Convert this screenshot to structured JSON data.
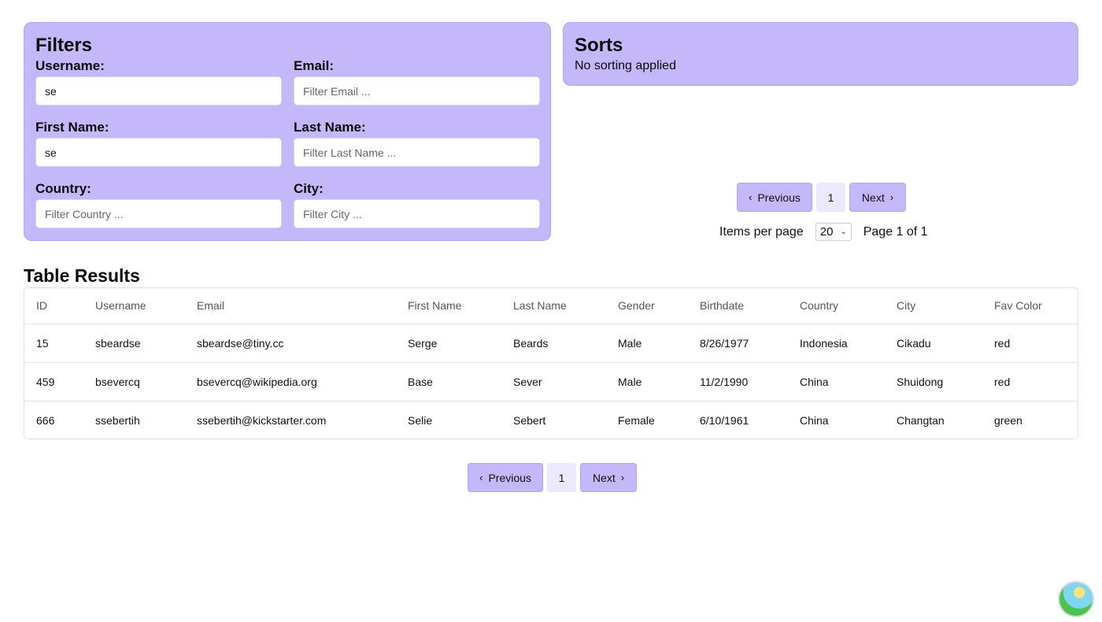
{
  "filters": {
    "title": "Filters",
    "fields": [
      {
        "label": "Username:",
        "value": "se",
        "placeholder": ""
      },
      {
        "label": "Email:",
        "value": "",
        "placeholder": "Filter Email ..."
      },
      {
        "label": "First Name:",
        "value": "se",
        "placeholder": ""
      },
      {
        "label": "Last Name:",
        "value": "",
        "placeholder": "Filter Last Name ..."
      },
      {
        "label": "Country:",
        "value": "",
        "placeholder": "Filter Country ..."
      },
      {
        "label": "City:",
        "value": "",
        "placeholder": "Filter City ..."
      }
    ]
  },
  "sorts": {
    "title": "Sorts",
    "status": "No sorting applied"
  },
  "pagination": {
    "previous_label": "Previous",
    "next_label": "Next",
    "current_page": "1",
    "items_per_page_label": "Items per page",
    "items_per_page_value": "20",
    "page_info": "Page 1 of 1"
  },
  "results": {
    "title": "Table Results",
    "columns": [
      "ID",
      "Username",
      "Email",
      "First Name",
      "Last Name",
      "Gender",
      "Birthdate",
      "Country",
      "City",
      "Fav Color"
    ],
    "rows": [
      [
        "15",
        "sbeardse",
        "sbeardse@tiny.cc",
        "Serge",
        "Beards",
        "Male",
        "8/26/1977",
        "Indonesia",
        "Cikadu",
        "red"
      ],
      [
        "459",
        "bsevercq",
        "bsevercq@wikipedia.org",
        "Base",
        "Sever",
        "Male",
        "11/2/1990",
        "China",
        "Shuidong",
        "red"
      ],
      [
        "666",
        "ssebertih",
        "ssebertih@kickstarter.com",
        "Selie",
        "Sebert",
        "Female",
        "6/10/1961",
        "China",
        "Changtan",
        "green"
      ]
    ]
  },
  "icons": {
    "prev": "chevron-left-icon",
    "next": "chevron-right-icon",
    "select": "chevron-down-icon",
    "avatar": "island-avatar-icon"
  },
  "colors": {
    "panel_bg": "#c4b8fb",
    "button_bg": "#c4b8fb",
    "current_page_bg": "#ece8fd"
  }
}
